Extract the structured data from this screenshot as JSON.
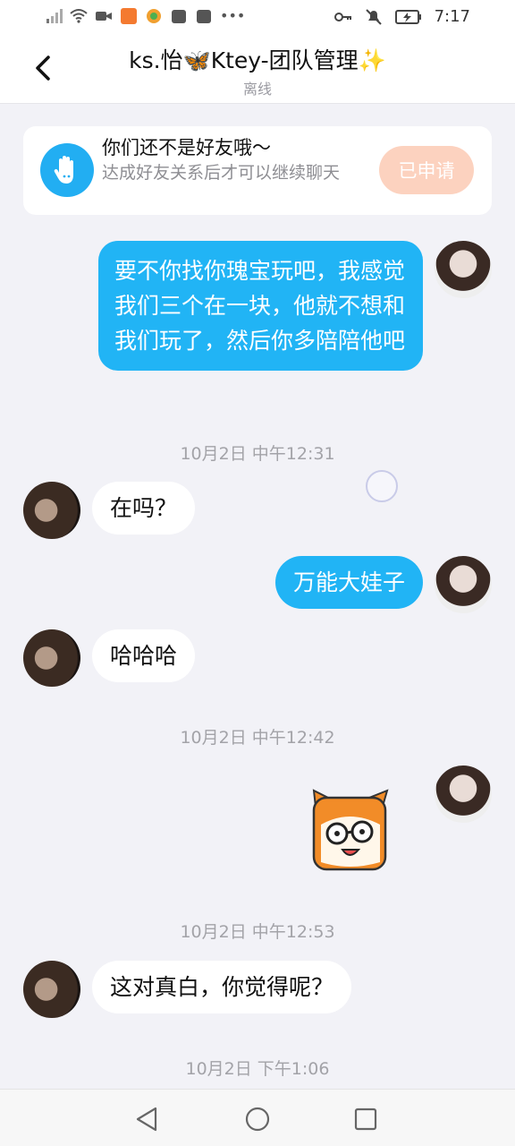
{
  "status_bar": {
    "time": "7:17",
    "left_icons": [
      "signal-icon",
      "wifi-icon",
      "video-icon",
      "app-icon",
      "app-icon",
      "bag-icon",
      "bag-icon",
      "more-dots-icon"
    ],
    "right_icons": [
      "key-icon",
      "mute-bell-icon",
      "battery-charging-icon"
    ]
  },
  "header": {
    "title": "ks.怡🦋Ktey-团队管理✨",
    "subtitle": "离线"
  },
  "notice": {
    "title": "你们还不是好友哦～",
    "desc": "达成好友关系后才可以继续聊天",
    "button": "已申请"
  },
  "messages": [
    {
      "side": "out",
      "type": "text",
      "text": "要不你找你瑰宝玩吧，我感觉我们三个在一块，他就不想和我们玩了，然后你多陪陪他吧"
    },
    {
      "type": "timestamp",
      "text": "10月2日 中午12:31"
    },
    {
      "side": "in",
      "type": "text",
      "text": "在吗？"
    },
    {
      "side": "out",
      "type": "text",
      "text": "万能大娃子"
    },
    {
      "side": "in",
      "type": "text",
      "text": "哈哈哈"
    },
    {
      "type": "timestamp",
      "text": "10月2日 中午12:42"
    },
    {
      "side": "out",
      "type": "sticker",
      "sticker": "cartoon-face-with-glasses"
    },
    {
      "type": "timestamp",
      "text": "10月2日 中午12:53"
    },
    {
      "side": "in",
      "type": "text",
      "text": "这对真白，你觉得呢？"
    },
    {
      "type": "timestamp",
      "text": "10月2日 下午1:06"
    }
  ],
  "colors": {
    "accent": "#21b4f5",
    "applied_button": "#fcd2bf",
    "background": "#f2f2f7"
  }
}
